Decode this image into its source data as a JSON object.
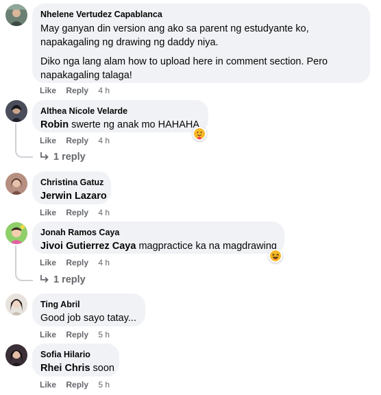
{
  "comments": [
    {
      "author": "Nhelene Vertudez Capablanca",
      "para1": "May ganyan din version ang ako sa parent ng estudyante ko, napakagaling ng drawing ng daddy niya.",
      "para2": "Diko nga lang alam how to upload here in comment section. Pero napakagaling talaga!",
      "like": "Like",
      "reply": "Reply",
      "time": "4 h"
    },
    {
      "author": "Althea Nicole Velarde",
      "tag": "Robin",
      "text": " swerte ng anak mo HAHAHA",
      "like": "Like",
      "reply": "Reply",
      "time": "4 h",
      "replies": "1 reply",
      "reaction_icon": "care-icon"
    },
    {
      "author": "Christina Gatuz",
      "tag": "Jerwin Lazaro",
      "like": "Like",
      "reply": "Reply",
      "time": "4 h"
    },
    {
      "author": "Jonah Ramos Caya",
      "tag": "Jivoi Gutierrez Caya",
      "text": " magpractice ka na magdrawing",
      "like": "Like",
      "reply": "Reply",
      "time": "4 h",
      "replies": "1 reply",
      "reaction_icon": "haha-icon"
    },
    {
      "author": "Ting Abril",
      "text": "Good job sayo tatay...",
      "like": "Like",
      "reply": "Reply",
      "time": "5 h"
    },
    {
      "author": "Sofia Hilario",
      "tag": "Rhei Chris",
      "text": " soon",
      "like": "Like",
      "reply": "Reply",
      "time": "5 h"
    }
  ],
  "colors": {
    "bubble": "#f0f2f5",
    "secondary_text": "#65676b",
    "thread_line": "#ced0d4"
  }
}
